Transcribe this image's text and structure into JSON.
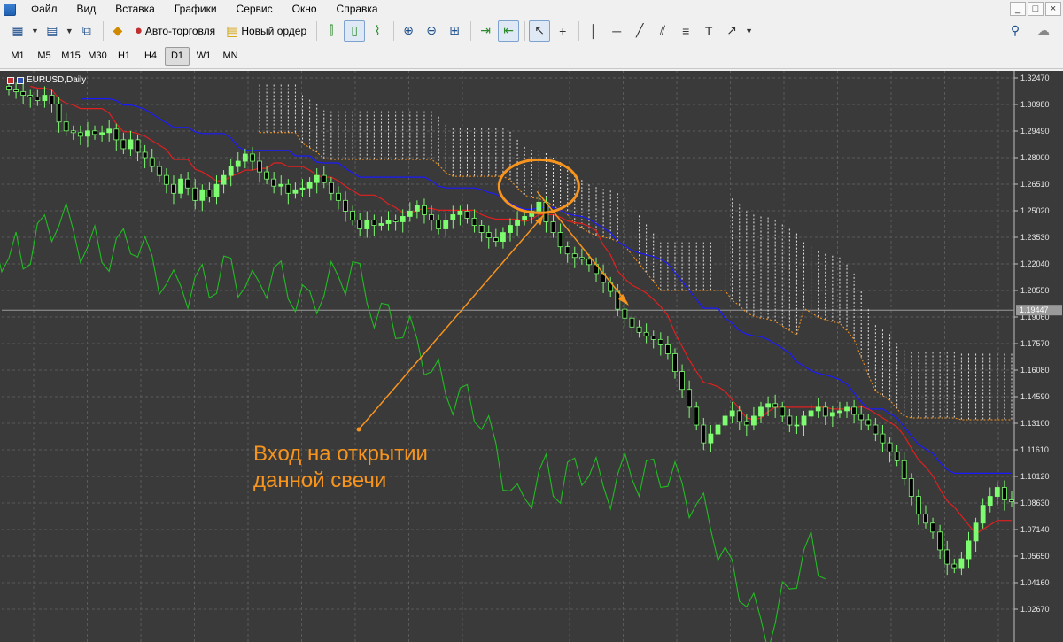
{
  "menu": {
    "items": [
      "Файл",
      "Вид",
      "Вставка",
      "Графики",
      "Сервис",
      "Окно",
      "Справка"
    ]
  },
  "window_controls": [
    "_",
    "□",
    "×"
  ],
  "toolbar": {
    "autotrading_label": "Авто-торговля",
    "new_order_label": "Новый ордер"
  },
  "timeframes": {
    "items": [
      "M1",
      "M5",
      "M15",
      "M30",
      "H1",
      "H4",
      "D1",
      "W1",
      "MN"
    ],
    "selected": "D1"
  },
  "chart": {
    "symbol_label": "EURUSD,Daily",
    "current_price": "1.19447",
    "price_axis": [
      "1.32470",
      "1.30980",
      "1.29490",
      "1.28000",
      "1.26510",
      "1.25020",
      "1.23530",
      "1.22040",
      "1.20550",
      "1.19060",
      "1.17570",
      "1.16080",
      "1.14590",
      "1.13100",
      "1.11610",
      "1.10120",
      "1.08630",
      "1.07140",
      "1.05650",
      "1.04160",
      "1.02670"
    ],
    "colors": {
      "background": "#000000",
      "grid": "#5a5a5a",
      "bull_candle": "#7dfc70",
      "bear_candle": "#000000",
      "tenkan": "#e02020",
      "kijun": "#1a1aff",
      "chikou": "#22bb22",
      "cloud": "#ffffff",
      "senkou_b": "#f7941d",
      "annotation": "#f7941d"
    },
    "annotation_line1": "Вход на открытии",
    "annotation_line2": "данной свечи"
  },
  "chart_data": {
    "type": "candlestick",
    "symbol": "EURUSD",
    "timeframe": "Daily",
    "ylim": [
      1.0267,
      1.3247
    ],
    "indicator": "Ichimoku Kinko Hyo",
    "close_series": [
      1.318,
      1.317,
      1.315,
      1.314,
      1.312,
      1.315,
      1.31,
      1.3,
      1.295,
      1.294,
      1.292,
      1.295,
      1.293,
      1.294,
      1.296,
      1.29,
      1.285,
      1.29,
      1.283,
      1.28,
      1.275,
      1.27,
      1.265,
      1.26,
      1.268,
      1.263,
      1.256,
      1.262,
      1.258,
      1.265,
      1.27,
      1.275,
      1.278,
      1.282,
      1.278,
      1.272,
      1.268,
      1.264,
      1.265,
      1.26,
      1.262,
      1.263,
      1.266,
      1.27,
      1.266,
      1.26,
      1.256,
      1.25,
      1.245,
      1.24,
      1.245,
      1.242,
      1.243,
      1.245,
      1.244,
      1.247,
      1.25,
      1.253,
      1.248,
      1.245,
      1.24,
      1.245,
      1.248,
      1.25,
      1.246,
      1.242,
      1.238,
      1.235,
      1.233,
      1.238,
      1.242,
      1.245,
      1.247,
      1.25,
      1.255,
      1.244,
      1.238,
      1.23,
      1.226,
      1.224,
      1.223,
      1.22,
      1.215,
      1.21,
      1.205,
      1.195,
      1.19,
      1.185,
      1.182,
      1.18,
      1.178,
      1.175,
      1.17,
      1.16,
      1.15,
      1.14,
      1.13,
      1.12,
      1.125,
      1.13,
      1.135,
      1.138,
      1.132,
      1.13,
      1.135,
      1.14,
      1.142,
      1.14,
      1.135,
      1.13,
      1.13,
      1.135,
      1.138,
      1.14,
      1.135,
      1.137,
      1.138,
      1.14,
      1.136,
      1.133,
      1.13,
      1.125,
      1.12,
      1.115,
      1.11,
      1.1,
      1.09,
      1.08,
      1.075,
      1.07,
      1.06,
      1.052,
      1.05,
      1.055,
      1.065,
      1.075,
      1.085,
      1.09,
      1.095,
      1.088,
      1.087
    ],
    "entry_point": {
      "price": 1.255,
      "label": "Вход на открытии данной свечи"
    }
  }
}
